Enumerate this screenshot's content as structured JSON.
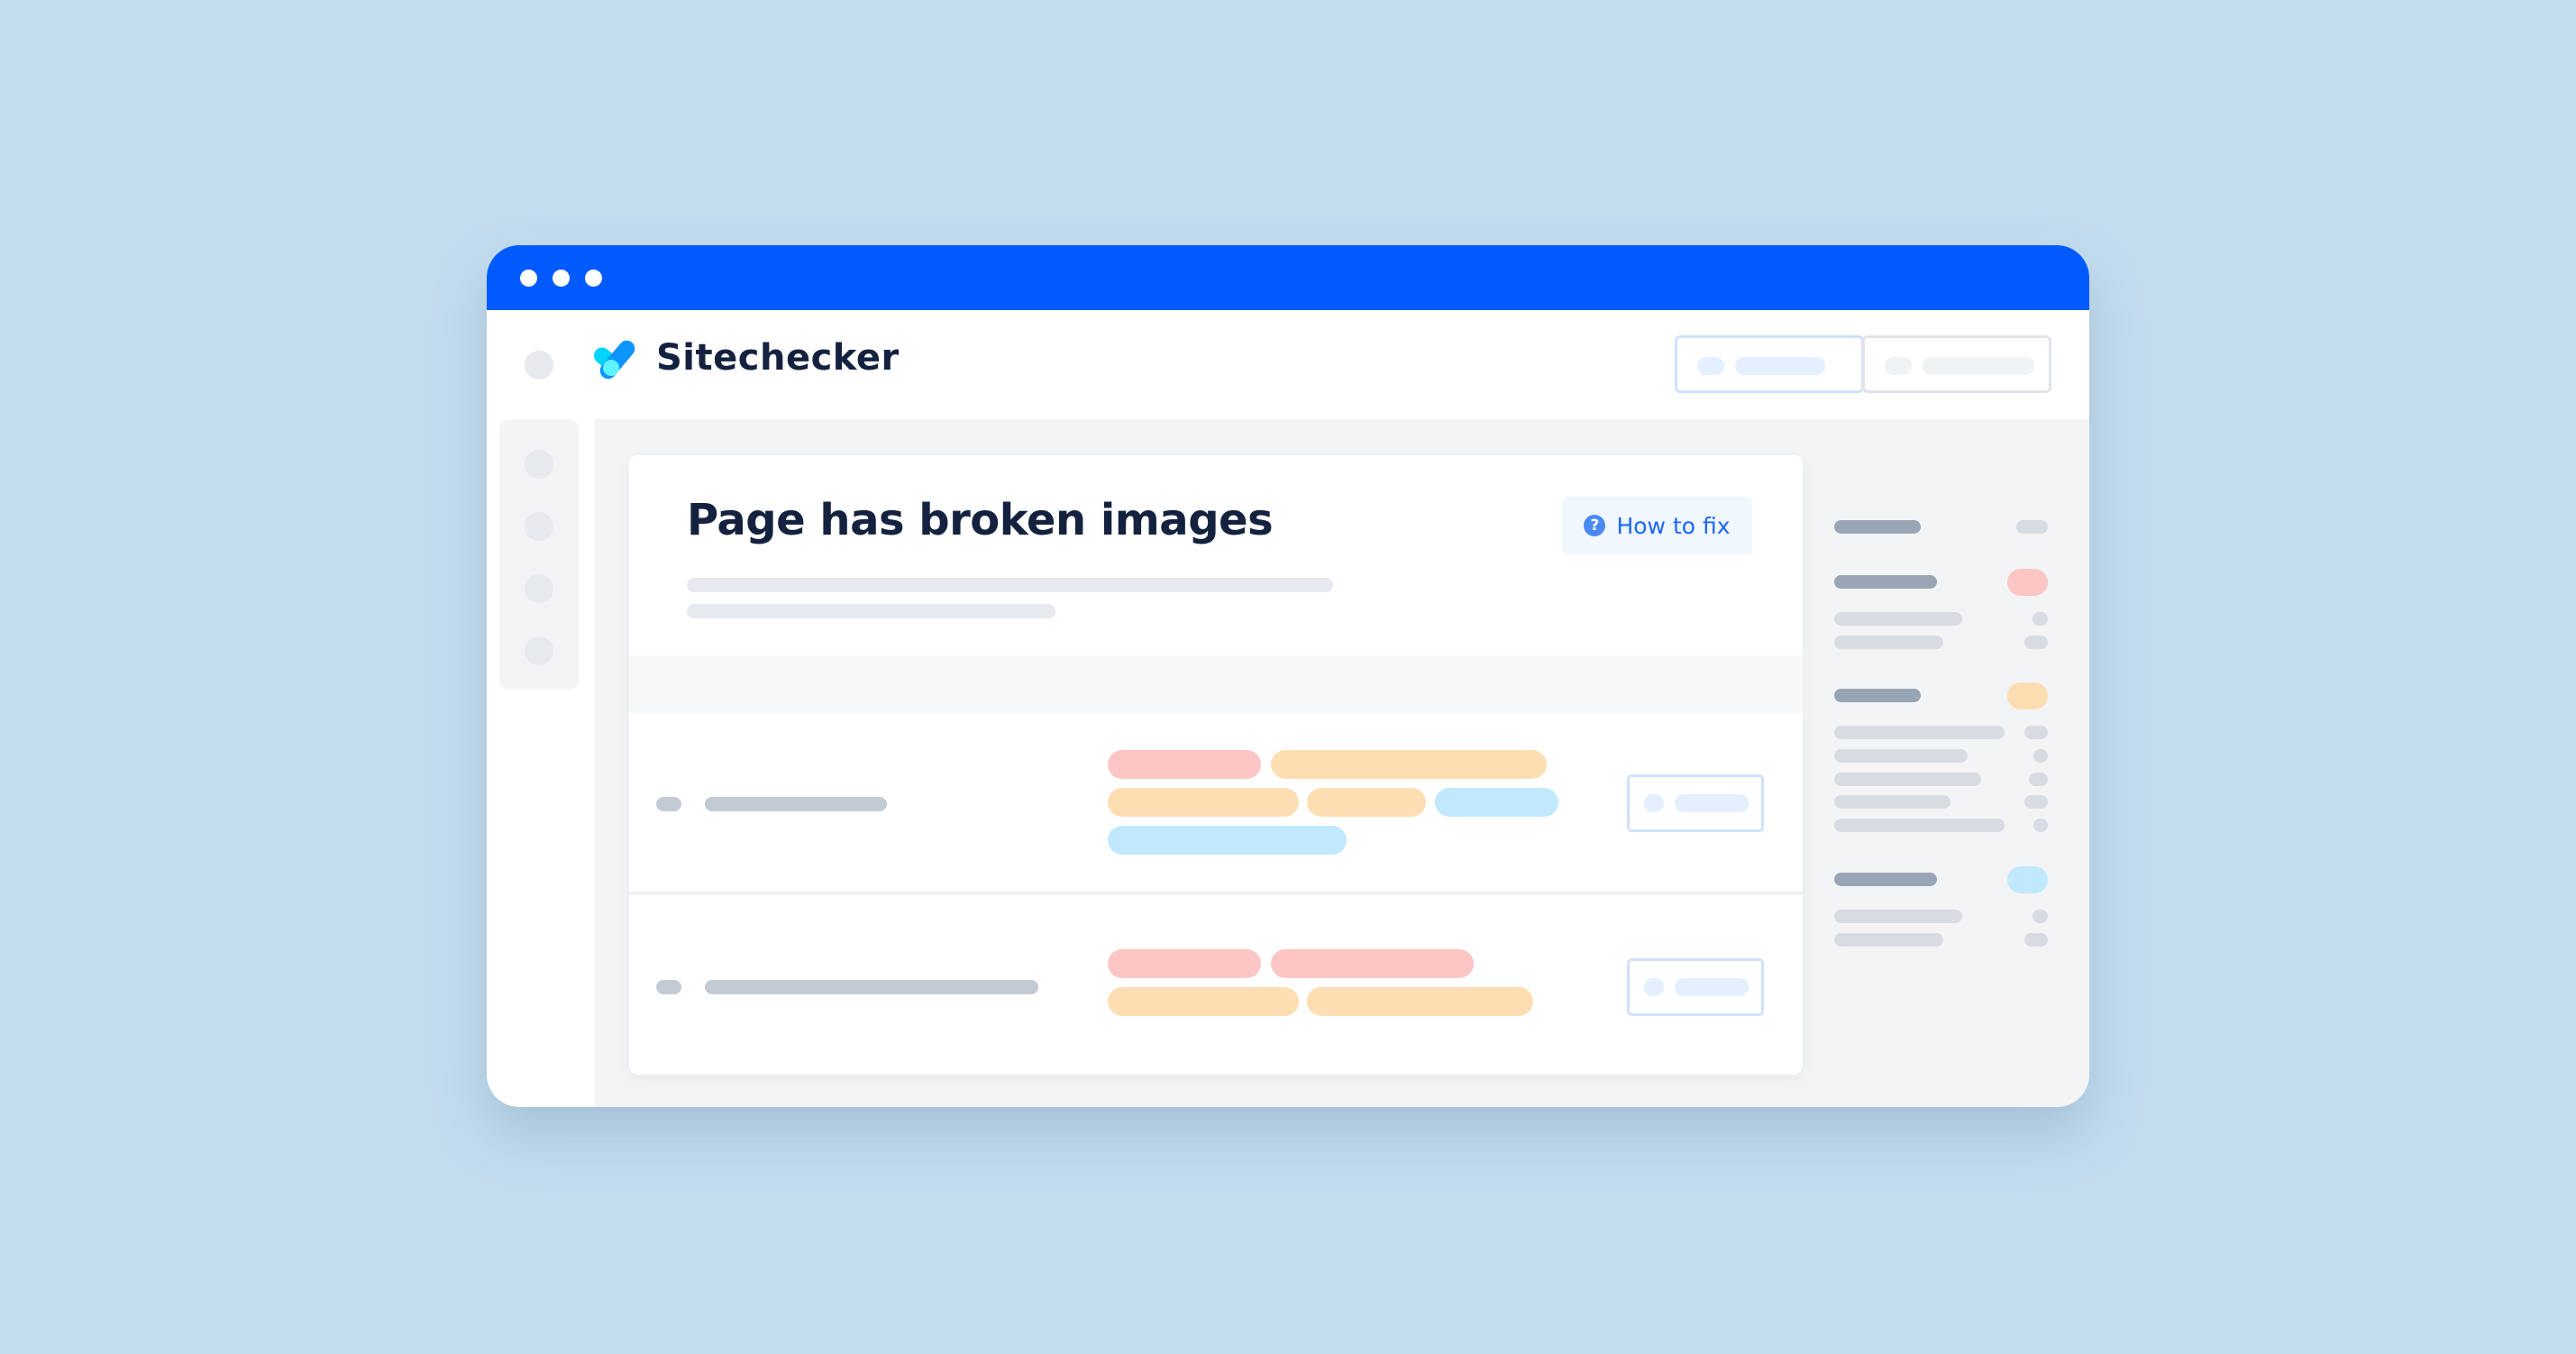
{
  "window": {
    "titlebar_color": "#005bff",
    "traffic_dots": [
      "dot",
      "dot",
      "dot"
    ]
  },
  "header": {
    "logo_icon": "checkmark-logo-icon",
    "brand_name": "Sitechecker",
    "buttons": [
      {
        "name": "primary-header-button",
        "style": "blue-outline"
      },
      {
        "name": "secondary-header-button",
        "style": "gray-outline"
      }
    ]
  },
  "sidebar": {
    "items": [
      "nav-item-1",
      "nav-item-2",
      "nav-item-3",
      "nav-item-4"
    ]
  },
  "card": {
    "title": "Page has broken images",
    "how_to_fix": {
      "icon": "question-circle-icon",
      "icon_glyph": "?",
      "label": "How to fix"
    },
    "rows": [
      {
        "tags": [
          [
            "red",
            "orange"
          ],
          [
            "orange",
            "orange",
            "blue"
          ],
          [
            "blue"
          ]
        ]
      },
      {
        "tags": [
          [
            "red",
            "red"
          ],
          [
            "orange",
            "orange"
          ]
        ]
      }
    ]
  },
  "right_panel": {
    "groups": [
      {
        "badge": "gray",
        "sub_items": 0
      },
      {
        "badge": "red",
        "badge_color": "#fbc6c4",
        "sub_items": 2
      },
      {
        "badge": "orange",
        "badge_color": "#fddeb3",
        "sub_items": 5
      },
      {
        "badge": "blue",
        "badge_color": "#c1e8fc",
        "sub_items": 2
      }
    ]
  },
  "colors": {
    "accent": "#005bff",
    "title_text": "#14223f",
    "link": "#1a66ff",
    "tag_red": "#fbc6c4",
    "tag_orange": "#fddeb3",
    "tag_blue": "#c1e8fc",
    "background": "#c3ddef"
  }
}
